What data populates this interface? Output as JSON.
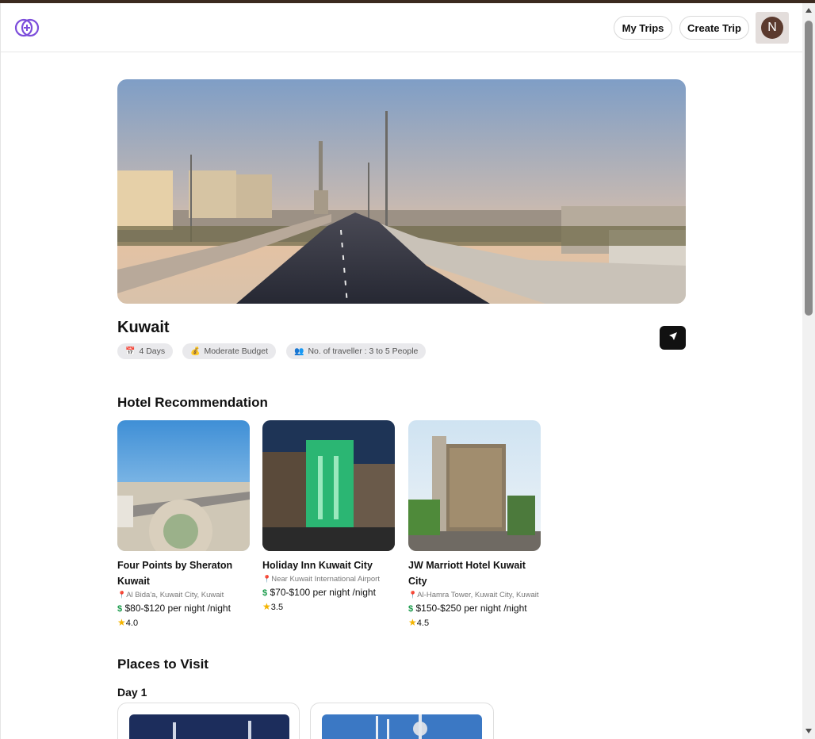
{
  "header": {
    "logo_name": "app-logo",
    "my_trips_label": "My Trips",
    "create_trip_label": "Create Trip",
    "avatar_initial": "N"
  },
  "trip": {
    "destination": "Kuwait",
    "chips": [
      {
        "icon": "calendar-icon",
        "label": "4 Days"
      },
      {
        "icon": "money-bag-icon",
        "label": "Moderate Budget"
      },
      {
        "icon": "people-icon",
        "label": "No. of traveller : 3 to 5 People"
      }
    ]
  },
  "hotels": {
    "title": "Hotel Recommendation",
    "items": [
      {
        "name": "Four Points by Sheraton Kuwait",
        "address": "Al Bida'a, Kuwait City, Kuwait",
        "price": "$80-$120 per night /night",
        "rating": "4.0"
      },
      {
        "name": "Holiday Inn Kuwait City",
        "address": "Near Kuwait International Airport",
        "price": "$70-$100 per night /night",
        "rating": "3.5"
      },
      {
        "name": "JW Marriott Hotel Kuwait City",
        "address": "Al-Hamra Tower, Kuwait City, Kuwait",
        "price": "$150-$250 per night /night",
        "rating": "4.5"
      }
    ]
  },
  "places": {
    "title": "Places to Visit",
    "day_label": "Day 1"
  },
  "colors": {
    "accent": "#7c4ddb",
    "dark_button": "#111111",
    "avatar_bg": "#5b3a2e"
  }
}
